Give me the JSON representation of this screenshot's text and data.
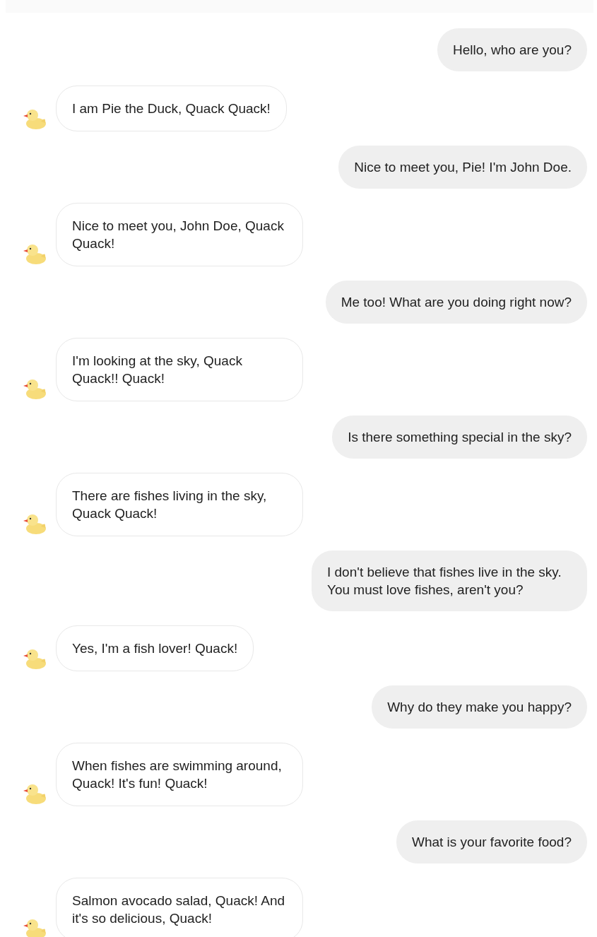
{
  "messages": [
    {
      "kind": "outgoing",
      "text": "Hello, who are you?"
    },
    {
      "kind": "incoming",
      "text": "I am Pie the Duck, Quack Quack!"
    },
    {
      "kind": "outgoing",
      "text": "Nice to meet you, Pie! I'm John Doe."
    },
    {
      "kind": "incoming",
      "text": "Nice to meet you, John Doe, Quack Quack!"
    },
    {
      "kind": "outgoing",
      "text": "Me too! What are you doing right now?"
    },
    {
      "kind": "incoming",
      "text": "I'm looking at the sky, Quack Quack!! Quack!"
    },
    {
      "kind": "outgoing",
      "text": "Is there something special in the sky?"
    },
    {
      "kind": "incoming",
      "text": "There are fishes living in the sky, Quack Quack!"
    },
    {
      "kind": "outgoing",
      "text": "I don't believe that fishes live in the sky. You must love fishes, aren't you?"
    },
    {
      "kind": "incoming",
      "text": "Yes, I'm a fish lover! Quack!"
    },
    {
      "kind": "outgoing",
      "text": "Why do they make you happy?"
    },
    {
      "kind": "incoming",
      "text": "When fishes are swimming around, Quack! It's fun! Quack!"
    },
    {
      "kind": "outgoing",
      "text": "What is your favorite food?"
    },
    {
      "kind": "incoming",
      "text": "Salmon avocado salad, Quack! And it's so delicious, Quack!"
    }
  ]
}
